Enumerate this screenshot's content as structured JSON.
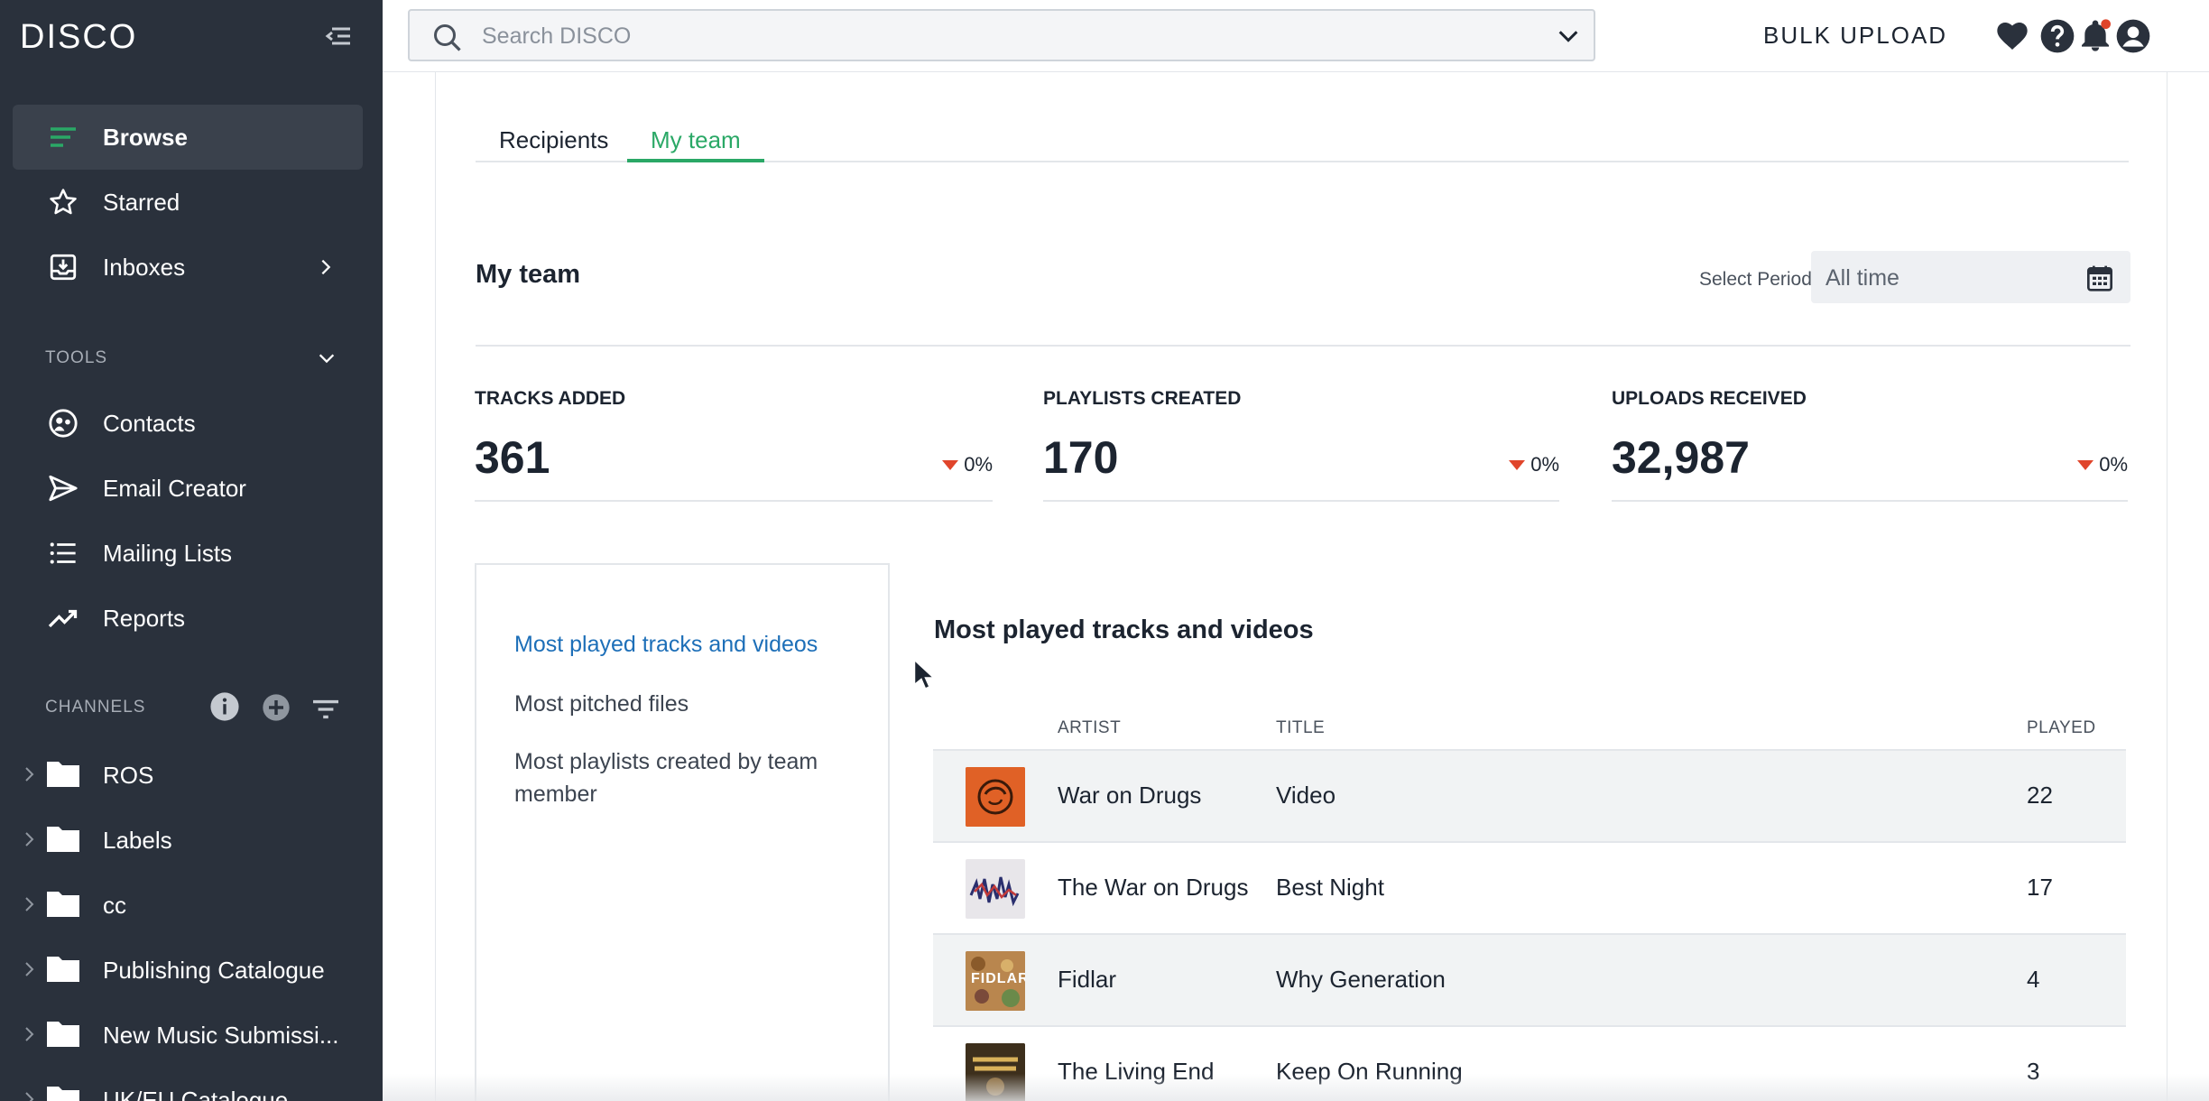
{
  "app": {
    "logo": "DISCO"
  },
  "sidebar": {
    "nav": [
      {
        "label": "Browse",
        "icon": "browse-lines-icon",
        "active": true
      },
      {
        "label": "Starred",
        "icon": "star-icon"
      },
      {
        "label": "Inboxes",
        "icon": "inbox-icon"
      }
    ],
    "tools_label": "TOOLS",
    "tools": [
      {
        "label": "Contacts",
        "icon": "contacts-icon"
      },
      {
        "label": "Email Creator",
        "icon": "send-icon"
      },
      {
        "label": "Mailing Lists",
        "icon": "list-icon"
      },
      {
        "label": "Reports",
        "icon": "trend-icon"
      }
    ],
    "channels_label": "CHANNELS",
    "channels": [
      {
        "label": "ROS"
      },
      {
        "label": "Labels"
      },
      {
        "label": "cc"
      },
      {
        "label": "Publishing Catalogue"
      },
      {
        "label": "New Music Submissi..."
      },
      {
        "label": "UK/EU Catalogue"
      }
    ]
  },
  "topbar": {
    "search_placeholder": "Search DISCO",
    "bulk_upload": "BULK UPLOAD"
  },
  "tabs": [
    {
      "label": "Recipients",
      "active": false
    },
    {
      "label": "My team",
      "active": true
    }
  ],
  "section": {
    "title": "My team",
    "period_label": "Select Period",
    "period_value": "All time"
  },
  "stats": [
    {
      "label": "TRACKS ADDED",
      "value": "361",
      "change": "0%"
    },
    {
      "label": "PLAYLISTS CREATED",
      "value": "170",
      "change": "0%"
    },
    {
      "label": "UPLOADS RECEIVED",
      "value": "32,987",
      "change": "0%"
    }
  ],
  "reports": [
    {
      "label": "Most played tracks and videos",
      "active": true
    },
    {
      "label": "Most pitched files"
    },
    {
      "label": "Most playlists created by team member"
    }
  ],
  "table": {
    "title": "Most played tracks and videos",
    "headers": {
      "artist": "ARTIST",
      "title": "TITLE",
      "played": "PLAYED"
    },
    "rows": [
      {
        "artist": "War on Drugs",
        "title": "Video",
        "played": "22",
        "art": "orange-swirl-artwork"
      },
      {
        "artist": "The War on Drugs",
        "title": "Best Night",
        "played": "17",
        "art": "blurred-portrait-artwork"
      },
      {
        "artist": "Fidlar",
        "title": "Why Generation",
        "played": "4",
        "art": "fidlar-artwork",
        "art_text": "FIDLAR"
      },
      {
        "artist": "The Living End",
        "title": "Keep On Running",
        "played": "3",
        "art": "living-end-artwork"
      }
    ]
  },
  "colors": {
    "sidebar_bg": "#2a313c",
    "accent_green": "#2aa866",
    "link_blue": "#1d6fb8",
    "down_red": "#e0452b"
  }
}
